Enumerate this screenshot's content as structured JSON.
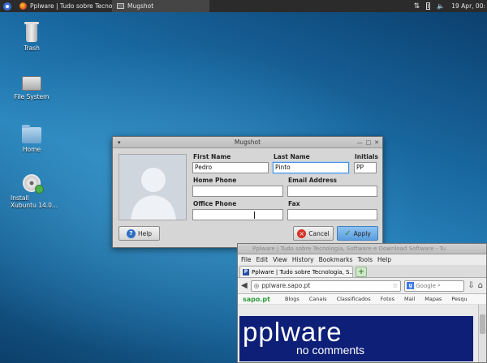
{
  "panel": {
    "tasks": [
      {
        "label": "Pplware | Tudo sobre Tecnolog...",
        "icon": "firefox-icon"
      },
      {
        "label": "Mugshot",
        "icon": "window-icon"
      }
    ],
    "clock": "19 Apr, 00:"
  },
  "desktop": {
    "icons": [
      {
        "label": "Trash",
        "icon": "trash-icon"
      },
      {
        "label": "File System",
        "icon": "drive-icon"
      },
      {
        "label": "Home",
        "icon": "folder-icon"
      },
      {
        "label": "Install\nXubuntu 14.0...",
        "icon": "install-cd-icon"
      }
    ]
  },
  "mugshot": {
    "title": "Mugshot",
    "first_name_label": "First Name",
    "first_name_value": "Pedro",
    "last_name_label": "Last Name",
    "last_name_value": "Pinto",
    "initials_label": "Initials",
    "initials_value": "PP",
    "home_phone_label": "Home Phone",
    "home_phone_value": "",
    "email_label": "Email Address",
    "email_value": "",
    "office_phone_label": "Office Phone",
    "office_phone_value": "",
    "fax_label": "Fax",
    "fax_value": "",
    "help_label": "Help",
    "cancel_label": "Cancel",
    "apply_label": "Apply"
  },
  "browser": {
    "title": "Pplware | Tudo sobre Tecnologia, Software e Download Software - Tu",
    "menus": [
      "File",
      "Edit",
      "View",
      "History",
      "Bookmarks",
      "Tools",
      "Help"
    ],
    "tab_label": "Pplware | Tudo sobre Tecnologia, S...",
    "url": "pplware.sapo.pt",
    "search_placeholder": "Google",
    "site_logo": "sapo.pt",
    "site_links": [
      "Blogs",
      "Canais",
      "Classificados",
      "Fotos",
      "Mail",
      "Mapas",
      "Pesqu"
    ],
    "banner_title": "pplware",
    "banner_subtitle": "no comments"
  },
  "colors": {
    "panel_bg": "#2b2b2b",
    "apply_accent": "#5a9fe0",
    "banner_bg": "#0e1f78"
  }
}
